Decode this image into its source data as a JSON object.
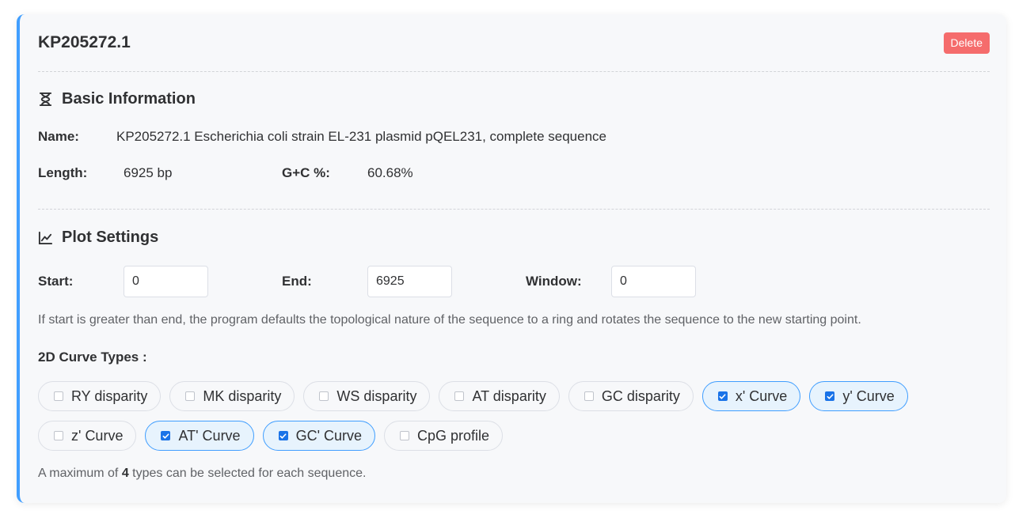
{
  "card": {
    "title": "KP205272.1",
    "delete_label": "Delete"
  },
  "basic_info": {
    "heading": "Basic Information",
    "heading_icon": "hourglass-icon",
    "name_label": "Name:",
    "name_value": "KP205272.1 Escherichia coli strain EL-231 plasmid pQEL231, complete sequence",
    "length_label": "Length:",
    "length_value": "6925 bp",
    "gc_label": "G+C %:",
    "gc_value": "60.68%"
  },
  "plot_settings": {
    "heading": "Plot Settings",
    "heading_icon": "line-chart-icon",
    "start_label": "Start:",
    "start_value": "0",
    "end_label": "End:",
    "end_value": "6925",
    "window_label": "Window:",
    "window_value": "0",
    "hint": "If start is greater than end, the program defaults the topological nature of the sequence to a ring and rotates the sequence to the new starting point.",
    "curve_types_label": "2D Curve Types :",
    "curve_types": [
      {
        "label": "RY disparity",
        "checked": false
      },
      {
        "label": "MK disparity",
        "checked": false
      },
      {
        "label": "WS disparity",
        "checked": false
      },
      {
        "label": "AT disparity",
        "checked": false
      },
      {
        "label": "GC disparity",
        "checked": false
      },
      {
        "label": "x' Curve",
        "checked": true
      },
      {
        "label": "y' Curve",
        "checked": true
      },
      {
        "label": "z' Curve",
        "checked": false
      },
      {
        "label": "AT' Curve",
        "checked": true
      },
      {
        "label": "GC' Curve",
        "checked": true
      },
      {
        "label": "CpG profile",
        "checked": false
      }
    ],
    "max_note_prefix": "A maximum of ",
    "max_note_count": "4",
    "max_note_suffix": " types can be selected for each sequence."
  },
  "colors": {
    "accent": "#409eff",
    "delete": "#f56c6c",
    "checked_fill": "#e7f3fd"
  }
}
